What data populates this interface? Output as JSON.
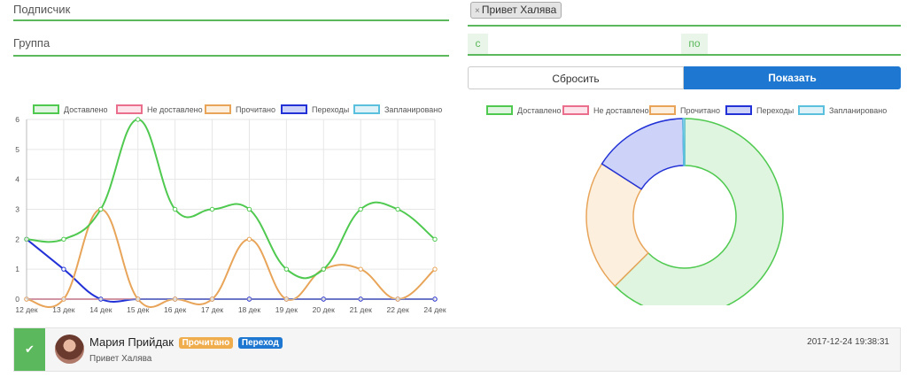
{
  "filters": {
    "subscriber_placeholder": "Подписчик",
    "group_placeholder": "Группа",
    "selected_tag": "Привет Халява",
    "tag_remove": "×",
    "date_from_label": "с",
    "date_to_label": "по"
  },
  "buttons": {
    "reset": "Сбросить",
    "show": "Показать"
  },
  "legend": [
    {
      "name": "Доставлено",
      "color": "#4fc94f",
      "fill": "#dff5df"
    },
    {
      "name": "Не доставлено",
      "color": "#e96f8c",
      "fill": "#fde3ea"
    },
    {
      "name": "Прочитано",
      "color": "#e8a55a",
      "fill": "#fcefde"
    },
    {
      "name": "Переходы",
      "color": "#2232d6",
      "fill": "#cdd2f8"
    },
    {
      "name": "Запланировано",
      "color": "#5bc0de",
      "fill": "#def2f8"
    }
  ],
  "chart_data": [
    {
      "type": "line",
      "x": [
        "12 дек",
        "13 дек",
        "14 дек",
        "15 дек",
        "16 дек",
        "17 дек",
        "18 дек",
        "19 дек",
        "20 дек",
        "21 дек",
        "22 дек",
        "24 дек"
      ],
      "ylim": [
        0,
        6
      ],
      "yticks": [
        0,
        1,
        2,
        3,
        4,
        5,
        6
      ],
      "grid": true,
      "legend_position": "top",
      "series": [
        {
          "name": "Доставлено",
          "values": [
            2,
            2,
            3,
            6,
            3,
            3,
            3,
            1,
            1,
            3,
            3,
            2
          ]
        },
        {
          "name": "Не доставлено",
          "values": [
            0,
            0,
            0,
            0,
            0,
            0,
            0,
            0,
            0,
            0,
            0,
            0
          ]
        },
        {
          "name": "Прочитано",
          "values": [
            0,
            0,
            3,
            0,
            0,
            0,
            2,
            0,
            1,
            1,
            0,
            1
          ]
        },
        {
          "name": "Переходы",
          "values": [
            2,
            1,
            0,
            0,
            0,
            0,
            0,
            0,
            0,
            0,
            0,
            0
          ]
        },
        {
          "name": "Запланировано",
          "values": [
            0,
            0,
            0,
            0,
            0,
            0,
            0,
            0,
            0,
            0,
            0,
            0
          ]
        }
      ]
    },
    {
      "type": "pie",
      "donut": true,
      "legend_position": "top",
      "slices": [
        {
          "name": "Доставлено",
          "value": 32
        },
        {
          "name": "Не доставлено",
          "value": 0
        },
        {
          "name": "Прочитано",
          "value": 11
        },
        {
          "name": "Переходы",
          "value": 8
        },
        {
          "name": "Запланировано",
          "value": 0.15
        }
      ]
    }
  ],
  "message": {
    "check_icon": "✔",
    "name": "Мария Прийдак",
    "badge_read": "Прочитано",
    "badge_click": "Переход",
    "text": "Привет Халява",
    "time": "2017-12-24 19:38:31"
  }
}
